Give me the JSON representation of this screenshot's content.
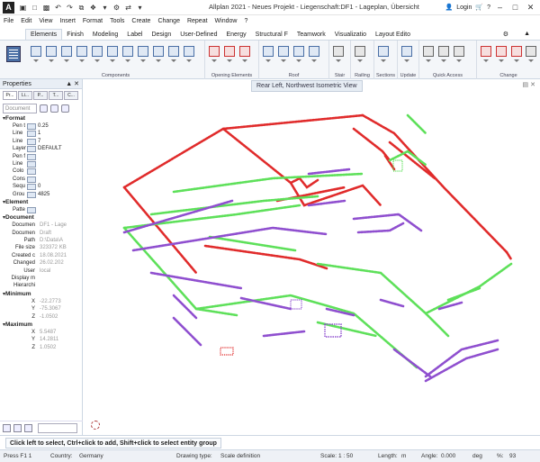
{
  "window": {
    "title": "Allplan 2021 - Neues Projekt - Liegenschaft:DF1 - Lageplan, Übersicht",
    "login_label": "Login"
  },
  "menu": [
    "File",
    "Edit",
    "View",
    "Insert",
    "Format",
    "Tools",
    "Create",
    "Change",
    "Repeat",
    "Window",
    "?"
  ],
  "ribbon_tabs": [
    "Elements",
    "Finish",
    "Modeling",
    "Label",
    "Design",
    "User-Defined",
    "Energy",
    "Structural F",
    "Teamwork",
    "Visualizatio",
    "Layout Edito"
  ],
  "ribbon_groups": [
    "Components",
    "Opening Elements",
    "Roof",
    "Stair",
    "Railing",
    "Sections",
    "Update",
    "Quick Access",
    "Change"
  ],
  "view_label": "Rear Left, Northwest Isometric View",
  "properties": {
    "title": "Properties",
    "subtabs": [
      "Pr...",
      "Li...",
      "P...",
      "T...",
      "C..."
    ],
    "selector": "Document",
    "format_header": "Format",
    "format_rows": [
      {
        "label": "Pen t",
        "value": "0.25"
      },
      {
        "label": "Line",
        "value": "1"
      },
      {
        "label": "Line",
        "value": "7"
      },
      {
        "label": "Layer",
        "value": "DEFAULT"
      },
      {
        "label": "Pen f",
        "value": ""
      },
      {
        "label": "Line",
        "value": ""
      },
      {
        "label": "Colo",
        "value": ""
      },
      {
        "label": "Cons",
        "value": ""
      },
      {
        "label": "Sequ",
        "value": "0"
      },
      {
        "label": "Grou",
        "value": "4825"
      }
    ],
    "element_header": "Element",
    "element_rows": [
      {
        "label": "Patte",
        "value": ""
      }
    ],
    "document_header": "Document",
    "document_rows": [
      {
        "label": "Documen",
        "value": "DF1 - Lage"
      },
      {
        "label": "Documen",
        "value": "Draft"
      },
      {
        "label": "Path",
        "value": "D:\\Data\\A"
      },
      {
        "label": "File size",
        "value": "323372 KB"
      },
      {
        "label": "Created c",
        "value": "18.08.2021"
      },
      {
        "label": "Changed",
        "value": "26.02.202"
      },
      {
        "label": "User",
        "value": "local"
      },
      {
        "label": "Display m",
        "value": ""
      },
      {
        "label": "Hierarchi",
        "value": ""
      }
    ],
    "minimum_header": "Minimum",
    "minimum_rows": [
      {
        "label": "X",
        "value": "-22.2773"
      },
      {
        "label": "Y",
        "value": "-75.3067"
      },
      {
        "label": "Z",
        "value": "-1.0502"
      }
    ],
    "maximum_header": "Maximum",
    "maximum_rows": [
      {
        "label": "X",
        "value": "5.5487"
      },
      {
        "label": "Y",
        "value": "14.2811"
      },
      {
        "label": "Z",
        "value": "1.0502"
      }
    ]
  },
  "prompt": "Click left to select, Ctrl+click to add, Shift+click to select entity group",
  "status": {
    "help": "Press F1 1",
    "country_label": "Country:",
    "country": "Germany",
    "drawing_type_label": "Drawing type:",
    "drawing_type": "Scale definition",
    "scale_label": "Scale:",
    "scale": "1 : 50",
    "length_label": "Length:",
    "length_unit": "m",
    "angle_label": "Angle:",
    "angle": "0.000",
    "angle_unit": "deg",
    "percent_label": "%:",
    "percent": "93"
  },
  "colors": {
    "red": "#e02b2b",
    "green": "#5ee05a",
    "purple": "#8f4fcf",
    "ribbon_bg": "#f4f6f9"
  }
}
